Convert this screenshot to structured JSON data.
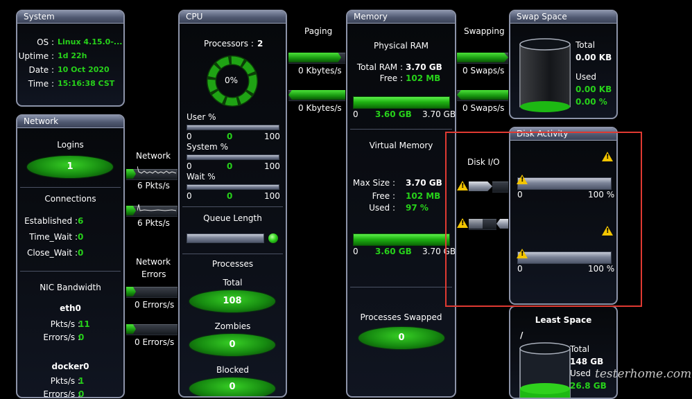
{
  "system": {
    "title": "System",
    "os_label": "OS :",
    "os_value": "Linux  4.15.0-...",
    "uptime_label": "Uptime :",
    "uptime_value": "1d 22h",
    "date_label": "Date :",
    "date_value": "10 Oct 2020",
    "time_label": "Time :",
    "time_value": "15:16:38 CST"
  },
  "network": {
    "title": "Network",
    "logins_label": "Logins",
    "logins_value": "1",
    "connections_label": "Connections",
    "established_label": "Established :",
    "established_value": "6",
    "time_wait_label": "Time_Wait :",
    "time_wait_value": "0",
    "close_wait_label": "Close_Wait :",
    "close_wait_value": "0",
    "nic_label": "NIC Bandwidth",
    "nics": [
      {
        "name": "eth0",
        "pkts_label": "Pkts/s :",
        "pkts_value": "11",
        "errors_label": "Errors/s :",
        "errors_value": "0"
      },
      {
        "name": "docker0",
        "pkts_label": "Pkts/s :",
        "pkts_value": "1",
        "errors_label": "Errors/s :",
        "errors_value": "0"
      }
    ]
  },
  "connectors": {
    "network_label": "Network",
    "network_rate_1": "6 Pkts/s",
    "network_rate_2": "6 Pkts/s",
    "network_errors_label_1": "Network",
    "network_errors_label_2": "Errors",
    "errors_rate_1": "0 Errors/s",
    "errors_rate_2": "0 Errors/s",
    "paging_label": "Paging",
    "paging_rate_1": "0 Kbytes/s",
    "paging_rate_2": "0 Kbytes/s",
    "swapping_label": "Swapping",
    "swap_rate_1": "0 Swaps/s",
    "swap_rate_2": "0 Swaps/s",
    "disk_io_label": "Disk I/O"
  },
  "cpu": {
    "title": "CPU",
    "processors_label": "Processors :",
    "processors_value": "2",
    "load_value": "0%",
    "user_label": "User %",
    "system_label": "System %",
    "wait_label": "Wait %",
    "scale_min": "0",
    "scale_value": "0",
    "scale_max": "100",
    "queue_label": "Queue Length",
    "processes_label": "Processes",
    "total_label": "Total",
    "total_value": "108",
    "zombies_label": "Zombies",
    "zombies_value": "0",
    "blocked_label": "Blocked",
    "blocked_value": "0"
  },
  "memory": {
    "title": "Memory",
    "physical_label": "Physical RAM",
    "total_ram_label": "Total RAM :",
    "total_ram_value": "3.70 GB",
    "free_label": "Free :",
    "free_value": "102 MB",
    "bar_min": "0",
    "bar_used": "3.60 GB",
    "bar_max": "3.70 GB",
    "used_fraction": 0.97,
    "virtual_label": "Virtual Memory",
    "max_size_label": "Max Size :",
    "max_size_value": "3.70 GB",
    "v_free_label": "Free :",
    "v_free_value": "102 MB",
    "v_used_label": "Used :",
    "v_used_value": "97 %",
    "v_bar_min": "0",
    "v_bar_used": "3.60 GB",
    "v_bar_max": "3.70 GB",
    "swapped_label": "Processes Swapped",
    "swapped_value": "0"
  },
  "swap": {
    "title": "Swap Space",
    "total_label": "Total",
    "total_value": "0.00 KB",
    "used_label": "Used",
    "used_value": "0.00 KB",
    "used_pct": "0.00 %"
  },
  "disk": {
    "title": "Disk Activity",
    "scale_min_1": "0",
    "scale_max_1": "100 %",
    "scale_min_2": "0",
    "scale_max_2": "100 %"
  },
  "space": {
    "title": "Least Space",
    "mount": "/",
    "total_label": "Total",
    "total_value": "148 GB",
    "used_label": "Used",
    "used_value": "26.8 GB"
  },
  "watermark": "testerhome.com",
  "colors": {
    "accent_green": "#27d11a",
    "highlight": "#e03a32",
    "panel_border": "#8c93a8"
  }
}
